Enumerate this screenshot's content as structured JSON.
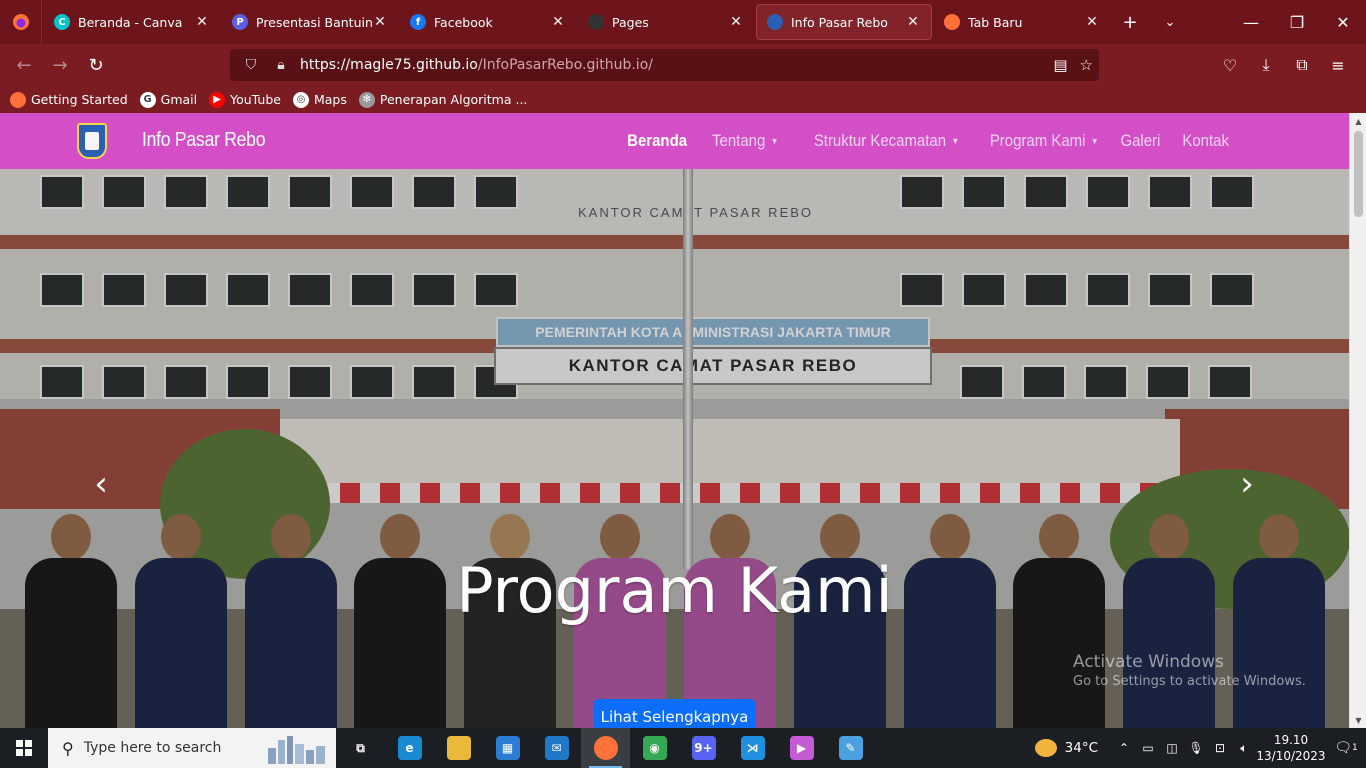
{
  "browser": {
    "tabs": [
      {
        "title": "Beranda - Canva",
        "icon": "canva-icon",
        "color": "#00c4cc",
        "glyph": "C"
      },
      {
        "title": "Presentasi Bantuinyuk",
        "icon": "shield-icon",
        "color": "#5b5fe0",
        "glyph": "P"
      },
      {
        "title": "Facebook",
        "icon": "facebook-icon",
        "color": "#1877f2",
        "glyph": "f"
      },
      {
        "title": "Pages",
        "icon": "github-icon",
        "color": "#333333",
        "glyph": ""
      },
      {
        "title": "Info Pasar Rebo",
        "icon": "site-logo-icon",
        "color": "#2b5fb4",
        "glyph": "",
        "active": true
      },
      {
        "title": "Tab Baru",
        "icon": "firefox-icon",
        "color": "#ff7139",
        "glyph": ""
      }
    ],
    "new_tab": "+",
    "url_host": "https://magle75.github.io",
    "url_path": "/InfoPasarRebo.github.io/",
    "bookmarks": [
      {
        "label": "Getting Started",
        "icon": "firefox-icon",
        "color": "#ff7139",
        "glyph": ""
      },
      {
        "label": "Gmail",
        "icon": "google-icon",
        "color": "#ffffff",
        "glyph": "G"
      },
      {
        "label": "YouTube",
        "icon": "youtube-icon",
        "color": "#ff0000",
        "glyph": "▶"
      },
      {
        "label": "Maps",
        "icon": "globe-icon",
        "color": "#ffffff",
        "glyph": "◎"
      },
      {
        "label": "Penerapan Algoritma ...",
        "icon": "openai-icon",
        "color": "#9a9a9a",
        "glyph": "✻"
      }
    ]
  },
  "site": {
    "brand": "Info Pasar Rebo",
    "nav_color": "#d44ec8",
    "menu": [
      {
        "label": "Beranda",
        "active": true,
        "dropdown": false
      },
      {
        "label": "Tentang",
        "active": false,
        "dropdown": true
      },
      {
        "label": "Struktur Kecamatan",
        "active": false,
        "dropdown": true
      },
      {
        "label": "Program Kami",
        "active": false,
        "dropdown": true
      },
      {
        "label": "Galeri",
        "active": false,
        "dropdown": false
      },
      {
        "label": "Kontak",
        "active": false,
        "dropdown": false
      }
    ],
    "hero": {
      "sign_top": "KANTOR CAMAT PASAR REBO",
      "sign_blue": "PEMERINTAH KOTA ADMINISTRASI JAKARTA TIMUR",
      "sign_white": "KANTOR CAMAT PASAR REBO",
      "caption": "Program Kami",
      "cta": "Lihat Selengkapnya",
      "prev": "‹",
      "next": "›"
    }
  },
  "watermark": {
    "line1": "Activate Windows",
    "line2": "Go to Settings to activate Windows."
  },
  "taskbar": {
    "search_placeholder": "Type here to search",
    "apps": [
      {
        "name": "task-view-icon",
        "color": "#1b1e22",
        "glyph": "⧉"
      },
      {
        "name": "edge-icon",
        "color": "#1a8ad4",
        "glyph": "e"
      },
      {
        "name": "file-explorer-icon",
        "color": "#e8b93a",
        "glyph": ""
      },
      {
        "name": "store-icon",
        "color": "#2b7cd3",
        "glyph": "▦"
      },
      {
        "name": "mail-icon",
        "color": "#1f78c8",
        "glyph": "✉"
      },
      {
        "name": "firefox-icon",
        "color": "#ff7139",
        "glyph": "",
        "active": true
      },
      {
        "name": "chrome-icon",
        "color": "#34a853",
        "glyph": "◉"
      },
      {
        "name": "discord-icon",
        "color": "#5865f2",
        "glyph": "9+"
      },
      {
        "name": "vscode-icon",
        "color": "#1f8fe0",
        "glyph": "⋊"
      },
      {
        "name": "media-player-icon",
        "color": "#c45ad4",
        "glyph": "▶"
      },
      {
        "name": "paint-icon",
        "color": "#4aa0e0",
        "glyph": "✎"
      }
    ],
    "temperature": "34°C",
    "time": "19.10",
    "date": "13/10/2023",
    "notifications": "1"
  }
}
